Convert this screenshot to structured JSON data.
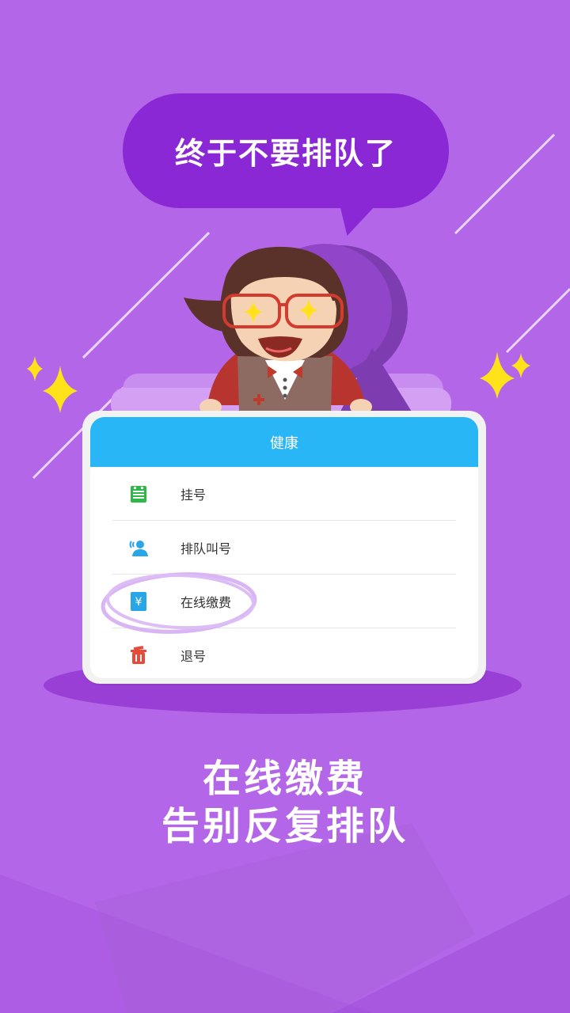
{
  "bubble": {
    "text": "终于不要排队了"
  },
  "card": {
    "title": "健康",
    "items": [
      {
        "label": "挂号",
        "icon": "register-sheet-icon",
        "color": "#2eb84a"
      },
      {
        "label": "排队叫号",
        "icon": "queue-call-icon",
        "color": "#29a6e8"
      },
      {
        "label": "在线缴费",
        "icon": "yuan-payment-icon",
        "color": "#29a6e8"
      },
      {
        "label": "退号",
        "icon": "trash-bin-icon",
        "color": "#e84a3a"
      }
    ]
  },
  "caption": {
    "line1": "在线缴费",
    "line2": "告别反复排队"
  },
  "colors": {
    "background": "#b466e8",
    "bubble": "#8a28d6",
    "card_header": "#29b6f6",
    "sparkle": "#ffe21a"
  }
}
